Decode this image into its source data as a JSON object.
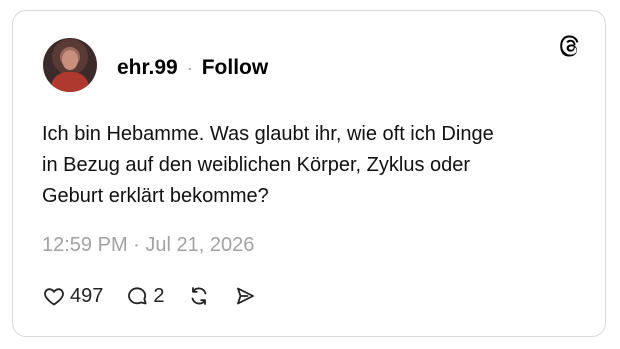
{
  "post": {
    "username": "ehr.99",
    "separator": "·",
    "follow_label": "Follow",
    "text_lines": [
      "Ich bin Hebamme. Was glaubt ihr, wie oft ich Dinge",
      "in Bezug auf den weiblichen Körper, Zyklus oder",
      "Geburt erklärt bekomme?"
    ],
    "timestamp": "12:59 PM · Jul 21, 2026",
    "likes": "497",
    "replies": "2"
  },
  "icons": {
    "logo": "threads-logo-icon",
    "like": "heart-icon",
    "reply": "comment-bubble-icon",
    "repost": "repost-icon",
    "share": "send-icon"
  }
}
